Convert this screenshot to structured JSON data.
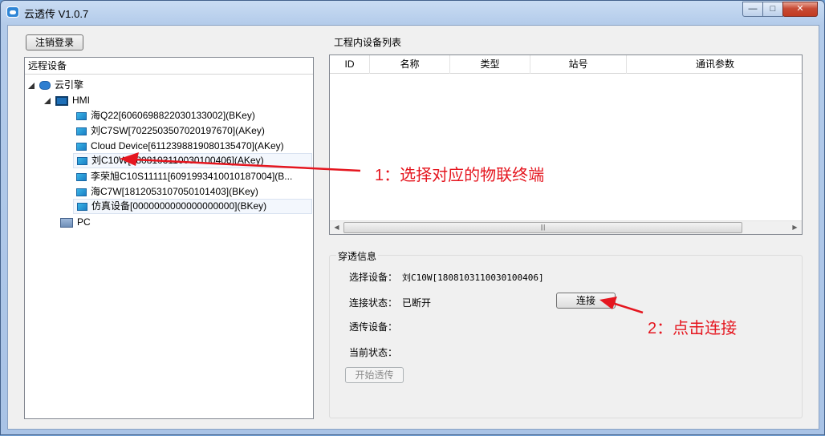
{
  "window": {
    "title": "云透传 V1.0.7",
    "buttons": {
      "minimize": "—",
      "maximize": "□",
      "close": "✕"
    }
  },
  "toolbar": {
    "logout_label": "注销登录"
  },
  "tree": {
    "header": "远程设备",
    "root": "云引擎",
    "group_hmi": "HMI",
    "devices": [
      "海Q22[6060698822030133002](BKey)",
      "刘C7SW[7022503507020197670](AKey)",
      "Cloud Device[6112398819080135470](AKey)",
      "刘C10W[1808103110030100406](AKey)",
      "李荣旭C10S11111[6091993410010187004](B...",
      "海C7W[1812053107050101403](BKey)",
      "仿真设备[0000000000000000000](BKey)"
    ],
    "group_pc": "PC"
  },
  "device_list": {
    "title": "工程内设备列表",
    "columns": [
      "ID",
      "名称",
      "类型",
      "站号",
      "通讯参数"
    ]
  },
  "passthrough": {
    "title": "穿透信息",
    "selected_label": "选择设备：",
    "selected_value": "刘C10W[1808103110030100406]",
    "conn_label": "连接状态：",
    "conn_value": "已断开",
    "connect_button": "连接",
    "pass_device_label": "透传设备：",
    "current_state_label": "当前状态：",
    "start_button": "开始透传"
  },
  "annotations": {
    "step1": "1：选择对应的物联终端",
    "step2": "2：点击连接",
    "color": "#e5161f"
  }
}
